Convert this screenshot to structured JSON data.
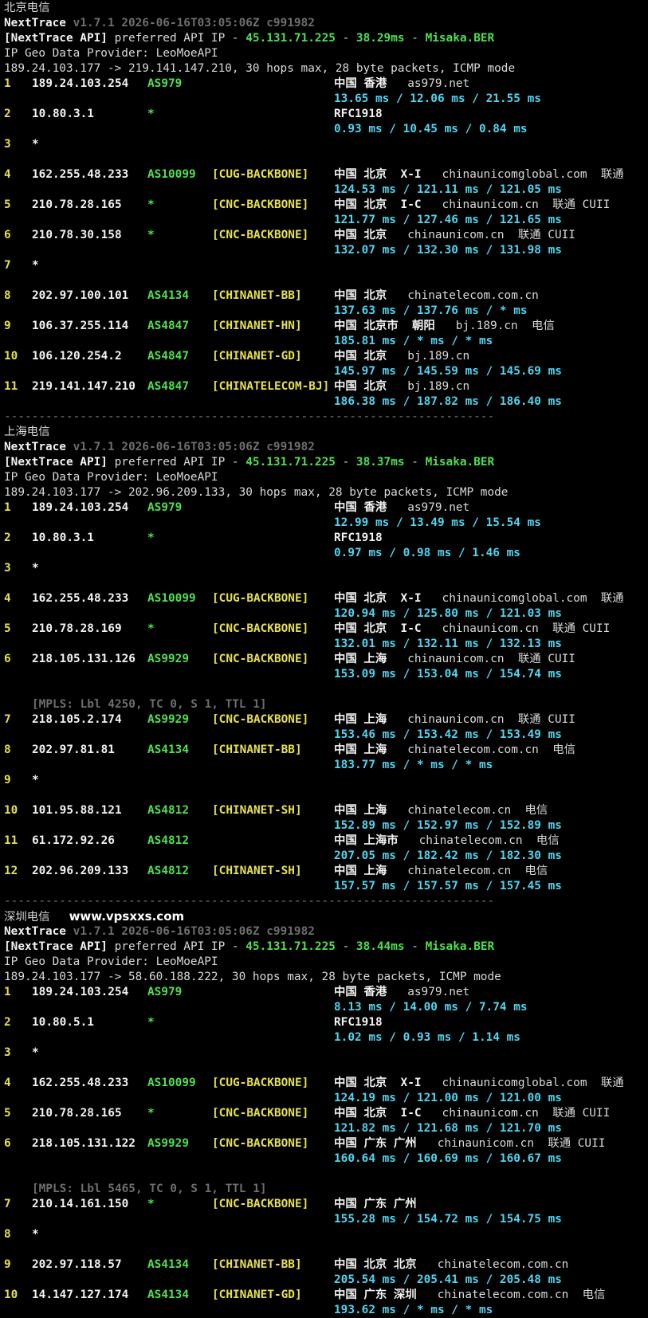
{
  "separator": "-----------------------------------------------------------------------",
  "sections": [
    {
      "title": "北京电信",
      "header": {
        "tool": "NextTrace",
        "version": "v1.7.1 2026-06-16T03:05:06Z c991982",
        "api_tag": "[NextTrace API]",
        "api_text": "preferred API IP - ",
        "api_ip": "45.131.71.225",
        "api_dash": " - ",
        "api_ms": "38.29ms",
        "api_dash2": " - ",
        "api_node": "Misaka.BER",
        "geo": "IP Geo Data Provider: LeoMoeAPI",
        "route": "189.24.103.177 -> 219.141.147.210, 30 hops max, 28 byte packets, ICMP mode"
      },
      "hops": [
        {
          "n": "1",
          "ip": "189.24.103.254",
          "asn": "AS979",
          "tag": "",
          "geo": "中国 香港",
          "host": "as979.net",
          "isp": "",
          "rtt": "13.65 ms / 12.06 ms / 21.55 ms"
        },
        {
          "n": "2",
          "ip": "10.80.3.1",
          "asn": "*",
          "tag": "",
          "geo": "RFC1918",
          "host": "",
          "isp": "",
          "rtt": "0.93 ms / 10.45 ms / 0.84 ms"
        },
        {
          "n": "3",
          "star": "*"
        },
        {
          "n": "4",
          "ip": "162.255.48.233",
          "asn": "AS10099",
          "tag": "[CUG-BACKBONE]",
          "geo": "中国 北京  X-I",
          "host": "chinaunicomglobal.com",
          "isp": "联通",
          "rtt": "124.53 ms / 121.11 ms / 121.05 ms"
        },
        {
          "n": "5",
          "ip": "210.78.28.165",
          "asn": "*",
          "tag": "[CNC-BACKBONE]",
          "geo": "中国 北京  I-C",
          "host": "chinaunicom.cn",
          "isp": "联通 CUII",
          "rtt": "121.77 ms / 127.46 ms / 121.65 ms"
        },
        {
          "n": "6",
          "ip": "210.78.30.158",
          "asn": "*",
          "tag": "[CNC-BACKBONE]",
          "geo": "中国 北京",
          "host": "chinaunicom.cn",
          "isp": "联通 CUII",
          "rtt": "132.07 ms / 132.30 ms / 131.98 ms"
        },
        {
          "n": "7",
          "star": "*"
        },
        {
          "n": "8",
          "ip": "202.97.100.101",
          "asn": "AS4134",
          "tag": "[CHINANET-BB]",
          "geo": "中国 北京",
          "host": "chinatelecom.com.cn",
          "isp": "",
          "rtt": "137.63 ms / 137.76 ms / * ms"
        },
        {
          "n": "9",
          "ip": "106.37.255.114",
          "asn": "AS4847",
          "tag": "[CHINANET-HN]",
          "geo": "中国 北京市  朝阳",
          "host": "bj.189.cn",
          "isp": "电信",
          "rtt": "185.81 ms / * ms / * ms"
        },
        {
          "n": "10",
          "ip": "106.120.254.2",
          "asn": "AS4847",
          "tag": "[CHINANET-GD]",
          "geo": "中国 北京",
          "host": "bj.189.cn",
          "isp": "",
          "rtt": "145.97 ms / 145.59 ms / 145.69 ms"
        },
        {
          "n": "11",
          "ip": "219.141.147.210",
          "asn": "AS4847",
          "tag": "[CHINATELECOM-BJ]",
          "geo": "中国 北京",
          "host": "bj.189.cn",
          "isp": "",
          "rtt": "186.38 ms / 187.82 ms / 186.40 ms"
        }
      ]
    },
    {
      "title": "上海电信",
      "header": {
        "tool": "NextTrace",
        "version": "v1.7.1 2026-06-16T03:05:06Z c991982",
        "api_tag": "[NextTrace API]",
        "api_text": "preferred API IP - ",
        "api_ip": "45.131.71.225",
        "api_dash": " - ",
        "api_ms": "38.37ms",
        "api_dash2": " - ",
        "api_node": "Misaka.BER",
        "geo": "IP Geo Data Provider: LeoMoeAPI",
        "route": "189.24.103.177 -> 202.96.209.133, 30 hops max, 28 byte packets, ICMP mode"
      },
      "hops": [
        {
          "n": "1",
          "ip": "189.24.103.254",
          "asn": "AS979",
          "tag": "",
          "geo": "中国 香港",
          "host": "as979.net",
          "isp": "",
          "rtt": "12.99 ms / 13.49 ms / 15.54 ms"
        },
        {
          "n": "2",
          "ip": "10.80.3.1",
          "asn": "*",
          "tag": "",
          "geo": "RFC1918",
          "host": "",
          "isp": "",
          "rtt": "0.97 ms / 0.98 ms / 1.46 ms"
        },
        {
          "n": "3",
          "star": "*"
        },
        {
          "n": "4",
          "ip": "162.255.48.233",
          "asn": "AS10099",
          "tag": "[CUG-BACKBONE]",
          "geo": "中国 北京  X-I",
          "host": "chinaunicomglobal.com",
          "isp": "联通",
          "rtt": "120.94 ms / 125.80 ms / 121.03 ms"
        },
        {
          "n": "5",
          "ip": "210.78.28.169",
          "asn": "*",
          "tag": "[CNC-BACKBONE]",
          "geo": "中国 北京  I-C",
          "host": "chinaunicom.cn",
          "isp": "联通 CUII",
          "rtt": "132.01 ms / 132.11 ms / 132.13 ms"
        },
        {
          "n": "6",
          "ip": "218.105.131.126",
          "asn": "AS9929",
          "tag": "[CNC-BACKBONE]",
          "geo": "中国 上海",
          "host": "chinaunicom.cn",
          "isp": "联通 CUII",
          "rtt": "153.09 ms / 153.04 ms / 154.74 ms",
          "mpls": "[MPLS: Lbl 4250, TC 0, S 1, TTL 1]"
        },
        {
          "n": "7",
          "ip": "218.105.2.174",
          "asn": "AS9929",
          "tag": "[CNC-BACKBONE]",
          "geo": "中国 上海",
          "host": "chinaunicom.cn",
          "isp": "联通 CUII",
          "rtt": "153.46 ms / 153.42 ms / 153.49 ms"
        },
        {
          "n": "8",
          "ip": "202.97.81.81",
          "asn": "AS4134",
          "tag": "[CHINANET-BB]",
          "geo": "中国 上海",
          "host": "chinatelecom.com.cn",
          "isp": "电信",
          "rtt": "183.77 ms / * ms / * ms"
        },
        {
          "n": "9",
          "star": "*"
        },
        {
          "n": "10",
          "ip": "101.95.88.121",
          "asn": "AS4812",
          "tag": "[CHINANET-SH]",
          "geo": "中国 上海",
          "host": "chinatelecom.cn",
          "isp": "电信",
          "rtt": "152.89 ms / 152.97 ms / 152.89 ms"
        },
        {
          "n": "11",
          "ip": "61.172.92.26",
          "asn": "AS4812",
          "tag": "",
          "geo": "中国 上海市",
          "host": "chinatelecom.cn",
          "isp": "电信",
          "rtt": "207.05 ms / 182.42 ms / 182.30 ms"
        },
        {
          "n": "12",
          "ip": "202.96.209.133",
          "asn": "AS4812",
          "tag": "[CHINANET-SH]",
          "geo": "中国 上海",
          "host": "chinatelecom.cn",
          "isp": "电信",
          "rtt": "157.57 ms / 157.57 ms / 157.45 ms"
        }
      ]
    },
    {
      "title": "深圳电信",
      "watermark": "www.vpsxxs.com",
      "header": {
        "tool": "NextTrace",
        "version": "v1.7.1 2026-06-16T03:05:06Z c991982",
        "api_tag": "[NextTrace API]",
        "api_text": "preferred API IP - ",
        "api_ip": "45.131.71.225",
        "api_dash": " - ",
        "api_ms": "38.44ms",
        "api_dash2": " - ",
        "api_node": "Misaka.BER",
        "geo": "IP Geo Data Provider: LeoMoeAPI",
        "route": "189.24.103.177 -> 58.60.188.222, 30 hops max, 28 byte packets, ICMP mode"
      },
      "hops": [
        {
          "n": "1",
          "ip": "189.24.103.254",
          "asn": "AS979",
          "tag": "",
          "geo": "中国 香港",
          "host": "as979.net",
          "isp": "",
          "rtt": "8.13 ms / 14.00 ms / 7.74 ms"
        },
        {
          "n": "2",
          "ip": "10.80.5.1",
          "asn": "*",
          "tag": "",
          "geo": "RFC1918",
          "host": "",
          "isp": "",
          "rtt": "1.02 ms / 0.93 ms / 1.14 ms"
        },
        {
          "n": "3",
          "star": "*"
        },
        {
          "n": "4",
          "ip": "162.255.48.233",
          "asn": "AS10099",
          "tag": "[CUG-BACKBONE]",
          "geo": "中国 北京  X-I",
          "host": "chinaunicomglobal.com",
          "isp": "联通",
          "rtt": "124.19 ms / 121.00 ms / 121.00 ms"
        },
        {
          "n": "5",
          "ip": "210.78.28.165",
          "asn": "*",
          "tag": "[CNC-BACKBONE]",
          "geo": "中国 北京  I-C",
          "host": "chinaunicom.cn",
          "isp": "联通 CUII",
          "rtt": "121.82 ms / 121.68 ms / 121.70 ms"
        },
        {
          "n": "6",
          "ip": "218.105.131.122",
          "asn": "AS9929",
          "tag": "[CNC-BACKBONE]",
          "geo": "中国 广东 广州",
          "host": "chinaunicom.cn",
          "isp": "联通 CUII",
          "rtt": "160.64 ms / 160.69 ms / 160.67 ms",
          "mpls": "[MPLS: Lbl 5465, TC 0, S 1, TTL 1]"
        },
        {
          "n": "7",
          "ip": "210.14.161.150",
          "asn": "*",
          "tag": "[CNC-BACKBONE]",
          "geo": "中国 广东 广州",
          "host": "",
          "isp": "",
          "rtt": "155.28 ms / 154.72 ms / 154.75 ms"
        },
        {
          "n": "8",
          "star": "*"
        },
        {
          "n": "9",
          "ip": "202.97.118.57",
          "asn": "AS4134",
          "tag": "[CHINANET-BB]",
          "geo": "中国 北京 北京",
          "host": "chinatelecom.com.cn",
          "isp": "",
          "rtt": "205.54 ms / 205.41 ms / 205.48 ms"
        },
        {
          "n": "10",
          "ip": "14.147.127.174",
          "asn": "AS4134",
          "tag": "[CHINANET-GD]",
          "geo": "中国 广东 深圳",
          "host": "chinatelecom.com.cn",
          "isp": "电信",
          "rtt": "193.62 ms / * ms / * ms"
        }
      ]
    }
  ]
}
